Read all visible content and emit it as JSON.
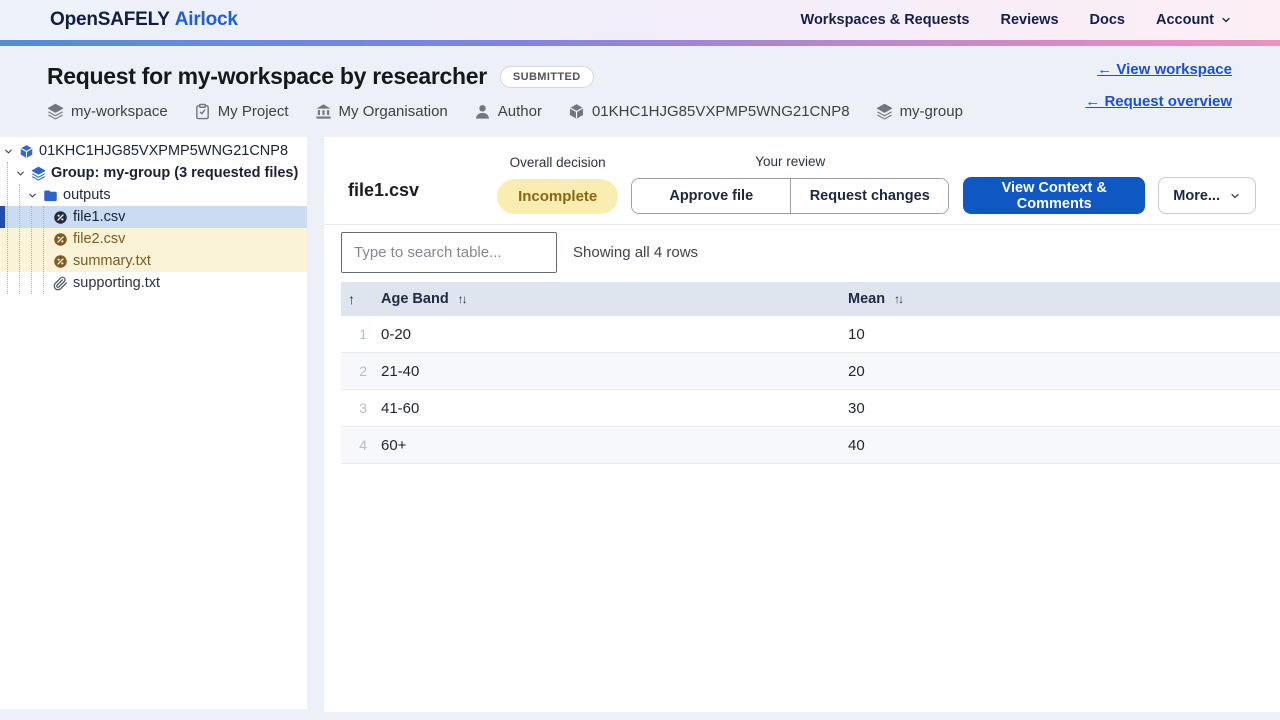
{
  "nav": {
    "brand": {
      "part1": "OpenSAFELY",
      "part2": "Airlock"
    },
    "items": [
      {
        "label": "Workspaces & Requests"
      },
      {
        "label": "Reviews"
      },
      {
        "label": "Docs"
      },
      {
        "label": "Account"
      }
    ]
  },
  "header": {
    "title": "Request for my-workspace by researcher",
    "status_badge": "SUBMITTED",
    "links": [
      {
        "label": "← View workspace"
      },
      {
        "label": "← Request overview"
      }
    ],
    "meta": [
      {
        "icon": "layers-icon",
        "label": "my-workspace"
      },
      {
        "icon": "clipboard-icon",
        "label": "My Project"
      },
      {
        "icon": "organisation-icon",
        "label": "My Organisation"
      },
      {
        "icon": "user-icon",
        "label": "Author"
      },
      {
        "icon": "cube-icon",
        "label": "01KHC1HJG85VXPMP5WNG21CNP8"
      },
      {
        "icon": "layers-icon",
        "label": "my-group"
      }
    ]
  },
  "sidebar": {
    "tree": [
      {
        "label": "01KHC1HJG85VXPMP5WNG21CNP8",
        "icon": "cube-icon",
        "level": 0,
        "expanded": true
      },
      {
        "label": "Group: my-group (3 requested files)",
        "icon": "layers-icon",
        "level": 1,
        "expanded": true
      },
      {
        "label": "outputs",
        "icon": "folder-icon",
        "level": 2,
        "expanded": true
      },
      {
        "label": "file1.csv",
        "icon": "file-chart-icon",
        "level": 3,
        "state": "selected"
      },
      {
        "label": "file2.csv",
        "icon": "file-chart-icon",
        "level": 3,
        "state": "highlighted"
      },
      {
        "label": "summary.txt",
        "icon": "file-chart-icon",
        "level": 3,
        "state": "highlighted"
      },
      {
        "label": "supporting.txt",
        "icon": "paperclip-icon",
        "level": 3,
        "state": "default"
      }
    ]
  },
  "main": {
    "file_title": "file1.csv",
    "overall_decision": {
      "label": "Overall decision",
      "value": "Incomplete"
    },
    "review": {
      "label": "Your review",
      "approve_label": "Approve file",
      "request_changes_label": "Request changes"
    },
    "context_button": "View Context & Comments",
    "more_button": "More...",
    "search": {
      "placeholder": "Type to search table...",
      "status": "Showing all 4 rows"
    },
    "table": {
      "sort_indicator_column": "row-number",
      "columns": [
        "Age Band",
        "Mean"
      ],
      "rows": [
        {
          "num": "1",
          "age_band": "0-20",
          "mean": "10"
        },
        {
          "num": "2",
          "age_band": "21-40",
          "mean": "20"
        },
        {
          "num": "3",
          "age_band": "41-60",
          "mean": "30"
        },
        {
          "num": "4",
          "age_band": "60+",
          "mean": "40"
        }
      ]
    }
  },
  "colors": {
    "brand_navy": "#101d45",
    "brand_blue": "#1d5fd6",
    "link_blue": "#1b4fd8",
    "primary_button_blue": "#0f58c4",
    "accent_gradient": [
      "#578cd4",
      "#7f85da",
      "#ee90bc"
    ],
    "status_incomplete_bg": "#f9edb2",
    "status_incomplete_text": "#8c6514",
    "selected_row_bg": "#cbdcf2",
    "selected_row_bar": "#1e4fae",
    "changed_row_bg": "#faf3d8",
    "changed_row_text": "#7d5c1e",
    "table_header_bg": "#dfe5ee",
    "page_bg": "#edf0f6"
  }
}
